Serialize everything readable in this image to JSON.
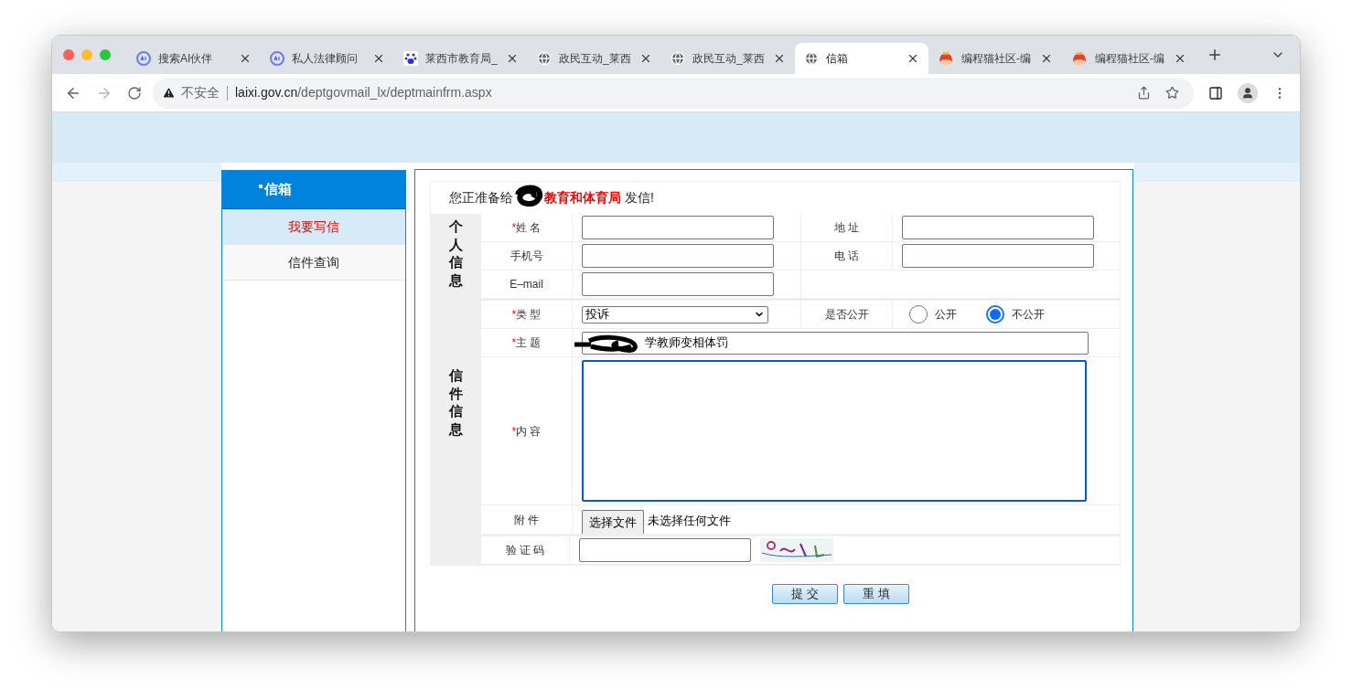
{
  "browser": {
    "tabs": [
      {
        "title": "搜索AI伙伴",
        "kind": "ai",
        "selected": false
      },
      {
        "title": "私人法律顾问",
        "kind": "ai",
        "selected": false
      },
      {
        "title": "莱西市教育局_",
        "kind": "paw",
        "selected": false
      },
      {
        "title": "政民互动_莱西",
        "kind": "globe",
        "selected": false
      },
      {
        "title": "政民互动_莱西",
        "kind": "globe",
        "selected": false
      },
      {
        "title": "信箱",
        "kind": "globe",
        "selected": true
      },
      {
        "title": "编程猫社区-编",
        "kind": "cat",
        "selected": false
      },
      {
        "title": "编程猫社区-编",
        "kind": "cat",
        "selected": false
      }
    ],
    "address": {
      "security": "不安全",
      "host": "laixi.gov.cn",
      "path": "/deptgovmail_lx/deptmainfrm.aspx"
    }
  },
  "sidebar": {
    "title": "信箱",
    "items": [
      {
        "label": "我要写信",
        "selected": true
      },
      {
        "label": "信件查询",
        "selected": false
      }
    ]
  },
  "form": {
    "intro": "您正准备给",
    "recipient": "教育和体育局",
    "intro_end": "发信!",
    "sections": [
      "个人信息",
      "信件信息"
    ],
    "personal": [
      [
        {
          "label": "姓 名",
          "required": true
        },
        {
          "label": "地 址",
          "required": false
        }
      ],
      [
        {
          "label": "手机号",
          "required": false
        },
        {
          "label": "电 话",
          "required": false
        }
      ],
      [
        {
          "label": "E–mail",
          "required": false
        }
      ]
    ],
    "type": {
      "label": "类 型",
      "required": true,
      "value": "投诉"
    },
    "public": {
      "label": "是否公开",
      "options": [
        {
          "label": "公开",
          "selected": false
        },
        {
          "label": "不公开",
          "selected": true
        }
      ]
    },
    "subject": {
      "label": "主 题",
      "required": true,
      "value": "学教师变相体罚"
    },
    "content": {
      "label": "内 容",
      "required": true,
      "focused": true
    },
    "attachment": {
      "label": "附 件",
      "button": "选择文件",
      "status": "未选择任何文件"
    },
    "captcha": {
      "label": "验 证 码"
    },
    "buttons": [
      "提 交",
      "重 填"
    ],
    "required_mark": "*"
  }
}
